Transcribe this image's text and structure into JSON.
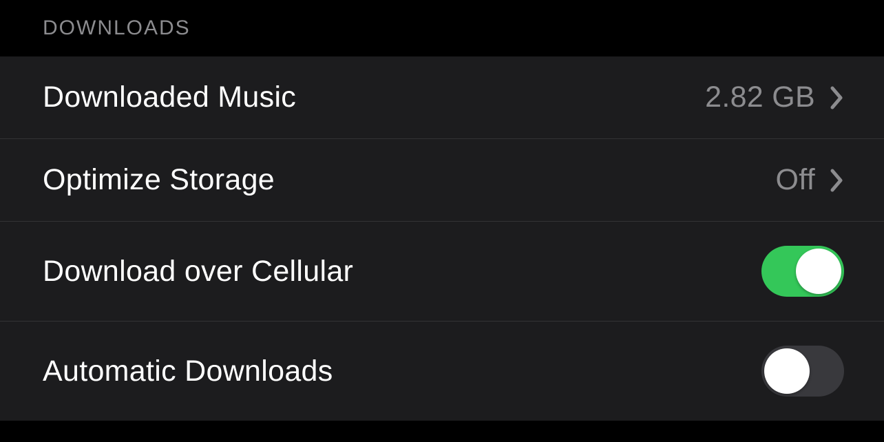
{
  "section": {
    "title": "DOWNLOADS"
  },
  "rows": {
    "downloaded_music": {
      "label": "Downloaded Music",
      "value": "2.82 GB"
    },
    "optimize_storage": {
      "label": "Optimize Storage",
      "value": "Off"
    },
    "download_cellular": {
      "label": "Download over Cellular",
      "toggle": true
    },
    "automatic_downloads": {
      "label": "Automatic Downloads",
      "toggle": false
    }
  }
}
